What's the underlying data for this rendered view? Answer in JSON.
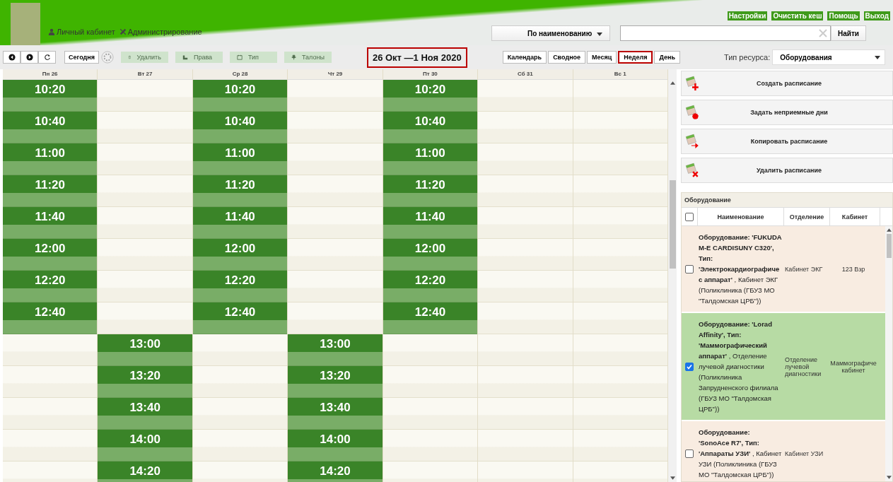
{
  "header": {
    "user_links": [
      {
        "kind": "user",
        "label": "Личный кабинет"
      },
      {
        "kind": "admin",
        "label": "Администрирование"
      }
    ],
    "top_links": [
      "Настройки",
      "Очистить кеш",
      "Помощь",
      "Выход"
    ],
    "search": {
      "mode": "По наименованию",
      "button": "Найти"
    }
  },
  "toolbar": {
    "nav": [
      {
        "kind": "prev"
      },
      {
        "kind": "next"
      },
      {
        "kind": "refresh"
      }
    ],
    "today": "Сегодня",
    "actions": [
      {
        "kind": "delete",
        "label": "Удалить",
        "disabled": true
      },
      {
        "kind": "rights",
        "label": "Права",
        "disabled": true
      },
      {
        "kind": "type",
        "label": "Тип",
        "disabled": true
      },
      {
        "kind": "tickets",
        "label": "Талоны",
        "disabled": true
      }
    ],
    "range": "26 Окт —1 Ноя 2020",
    "views": [
      {
        "label": "Календарь",
        "selected": false
      },
      {
        "label": "Сводное",
        "selected": false
      },
      {
        "label": "Месяц",
        "selected": false
      },
      {
        "label": "Неделя",
        "selected": true
      },
      {
        "label": "День",
        "selected": false
      }
    ],
    "resource_label": "Тип ресурса:",
    "resource_value": "Оборудования"
  },
  "calendar": {
    "days": [
      {
        "label": "Пн 26",
        "cells": [
          {
            "kind": "slot",
            "time": "10:20"
          },
          {
            "kind": "slot",
            "time": "10:40"
          },
          {
            "kind": "slot",
            "time": "11:00"
          },
          {
            "kind": "slot",
            "time": "11:20"
          },
          {
            "kind": "slot",
            "time": "11:40"
          },
          {
            "kind": "slot",
            "time": "12:00"
          },
          {
            "kind": "slot",
            "time": "12:20"
          },
          {
            "kind": "slot",
            "time": "12:40"
          },
          {
            "kind": "empty"
          },
          {
            "kind": "empty"
          },
          {
            "kind": "empty"
          },
          {
            "kind": "empty"
          },
          {
            "kind": "empty"
          }
        ]
      },
      {
        "label": "Вт 27",
        "cells": [
          {
            "kind": "empty"
          },
          {
            "kind": "empty"
          },
          {
            "kind": "empty"
          },
          {
            "kind": "empty"
          },
          {
            "kind": "empty"
          },
          {
            "kind": "empty"
          },
          {
            "kind": "empty"
          },
          {
            "kind": "empty"
          },
          {
            "kind": "slot",
            "time": "13:00"
          },
          {
            "kind": "slot",
            "time": "13:20"
          },
          {
            "kind": "slot",
            "time": "13:40"
          },
          {
            "kind": "slot",
            "time": "14:00"
          },
          {
            "kind": "slot",
            "time": "14:20"
          }
        ]
      },
      {
        "label": "Ср 28",
        "cells": [
          {
            "kind": "slot",
            "time": "10:20"
          },
          {
            "kind": "slot",
            "time": "10:40"
          },
          {
            "kind": "slot",
            "time": "11:00"
          },
          {
            "kind": "slot",
            "time": "11:20"
          },
          {
            "kind": "slot",
            "time": "11:40"
          },
          {
            "kind": "slot",
            "time": "12:00"
          },
          {
            "kind": "slot",
            "time": "12:20"
          },
          {
            "kind": "slot",
            "time": "12:40"
          },
          {
            "kind": "empty"
          },
          {
            "kind": "empty"
          },
          {
            "kind": "empty"
          },
          {
            "kind": "empty"
          },
          {
            "kind": "empty"
          }
        ]
      },
      {
        "label": "Чт 29",
        "cells": [
          {
            "kind": "empty"
          },
          {
            "kind": "empty"
          },
          {
            "kind": "empty"
          },
          {
            "kind": "empty"
          },
          {
            "kind": "empty"
          },
          {
            "kind": "empty"
          },
          {
            "kind": "empty"
          },
          {
            "kind": "empty"
          },
          {
            "kind": "slot",
            "time": "13:00"
          },
          {
            "kind": "slot",
            "time": "13:20"
          },
          {
            "kind": "slot",
            "time": "13:40"
          },
          {
            "kind": "slot",
            "time": "14:00"
          },
          {
            "kind": "slot",
            "time": "14:20"
          }
        ]
      },
      {
        "label": "Пт 30",
        "cells": [
          {
            "kind": "slot",
            "time": "10:20"
          },
          {
            "kind": "slot",
            "time": "10:40"
          },
          {
            "kind": "slot",
            "time": "11:00"
          },
          {
            "kind": "slot",
            "time": "11:20"
          },
          {
            "kind": "slot",
            "time": "11:40"
          },
          {
            "kind": "slot",
            "time": "12:00"
          },
          {
            "kind": "slot",
            "time": "12:20"
          },
          {
            "kind": "slot",
            "time": "12:40"
          },
          {
            "kind": "empty"
          },
          {
            "kind": "empty"
          },
          {
            "kind": "empty"
          },
          {
            "kind": "empty"
          },
          {
            "kind": "empty"
          }
        ]
      },
      {
        "label": "Сб 31",
        "cells": [
          {
            "kind": "empty"
          },
          {
            "kind": "empty"
          },
          {
            "kind": "empty"
          },
          {
            "kind": "empty"
          },
          {
            "kind": "empty"
          },
          {
            "kind": "empty"
          },
          {
            "kind": "empty"
          },
          {
            "kind": "empty"
          },
          {
            "kind": "empty"
          },
          {
            "kind": "empty"
          },
          {
            "kind": "empty"
          },
          {
            "kind": "empty"
          },
          {
            "kind": "empty"
          }
        ]
      },
      {
        "label": "Вс 1",
        "cells": [
          {
            "kind": "empty"
          },
          {
            "kind": "empty"
          },
          {
            "kind": "empty"
          },
          {
            "kind": "empty"
          },
          {
            "kind": "empty"
          },
          {
            "kind": "empty"
          },
          {
            "kind": "empty"
          },
          {
            "kind": "empty"
          },
          {
            "kind": "empty"
          },
          {
            "kind": "empty"
          },
          {
            "kind": "empty"
          },
          {
            "kind": "empty"
          },
          {
            "kind": "empty"
          }
        ]
      }
    ]
  },
  "side_actions": [
    {
      "kind": "create",
      "label": "Создать расписание"
    },
    {
      "kind": "exclude",
      "label": "Задать неприемные дни"
    },
    {
      "kind": "copy",
      "label": "Копировать расписание"
    },
    {
      "kind": "delete",
      "label": "Удалить расписание"
    }
  ],
  "equipment": {
    "title": "Оборудование",
    "select_all": false,
    "columns": [
      "Наименование",
      "Отделение",
      "Кабинет"
    ],
    "rows": [
      {
        "name": "**Оборудование: 'FUKUDA M-E CARDISUNY C320', Тип: 'Электрокардиографичес аппарат'** , Кабинет ЭКГ (Поликлиника (ГБУЗ МО \"Талдомская ЦРБ\"))",
        "department": "Кабинет ЭКГ",
        "room": "123 Взр",
        "checked": false
      },
      {
        "name": "**Оборудование: 'Lorad Affinity', Тип: 'Маммографический аппарат'** , Отделение лучевой диагностики (Поликлиника Запрудненского филиала (ГБУЗ МО \"Талдомская ЦРБ\"))",
        "department": "Отделение лучевой диагностики",
        "room": "Маммографиче кабинет",
        "checked": true
      },
      {
        "name": "**Оборудование: 'SonoAce R7', Тип: 'Аппараты УЗИ'** , Кабинет УЗИ (Поликлиника (ГБУЗ МО \"Талдомская ЦРБ\"))",
        "department": "Кабинет УЗИ",
        "checked": false
      }
    ]
  }
}
